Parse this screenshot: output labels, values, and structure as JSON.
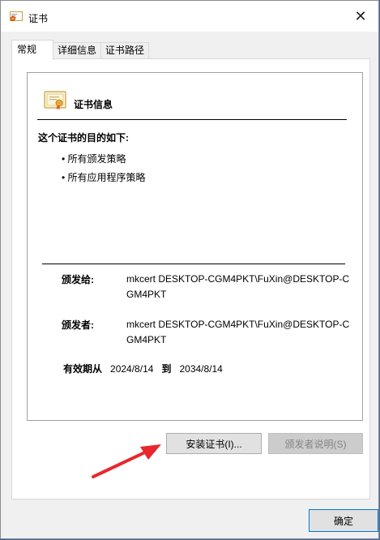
{
  "window": {
    "title": "证书",
    "close_glyph": "✕"
  },
  "tabs": [
    {
      "label": "常规",
      "active": true
    },
    {
      "label": "详细信息",
      "active": false
    },
    {
      "label": "证书路径",
      "active": false
    }
  ],
  "certificate": {
    "header": "证书信息",
    "purpose_label": "这个证书的目的如下:",
    "purposes": [
      "• 所有颁发策略",
      "• 所有应用程序策略"
    ],
    "issued_to_label": "颁发给:",
    "issued_to_value": "mkcert DESKTOP-CGM4PKT\\FuXin@DESKTOP-CGM4PKT",
    "issued_by_label": "颁发者:",
    "issued_by_value": "mkcert DESKTOP-CGM4PKT\\FuXin@DESKTOP-CGM4PKT",
    "valid_from_label": "有效期从",
    "valid_from": "2024/8/14",
    "valid_to_label": "到",
    "valid_to": "2034/8/14"
  },
  "buttons": {
    "install": "安装证书(I)...",
    "issuer_statement": "颁发者说明(S)",
    "ok": "确定"
  },
  "colors": {
    "annotation_arrow": "#e8272a",
    "focus_border": "#0078d7"
  },
  "icons": {
    "title": "certificate-icon",
    "header": "certificate-ribbon-icon",
    "annotation": "red-arrow"
  }
}
